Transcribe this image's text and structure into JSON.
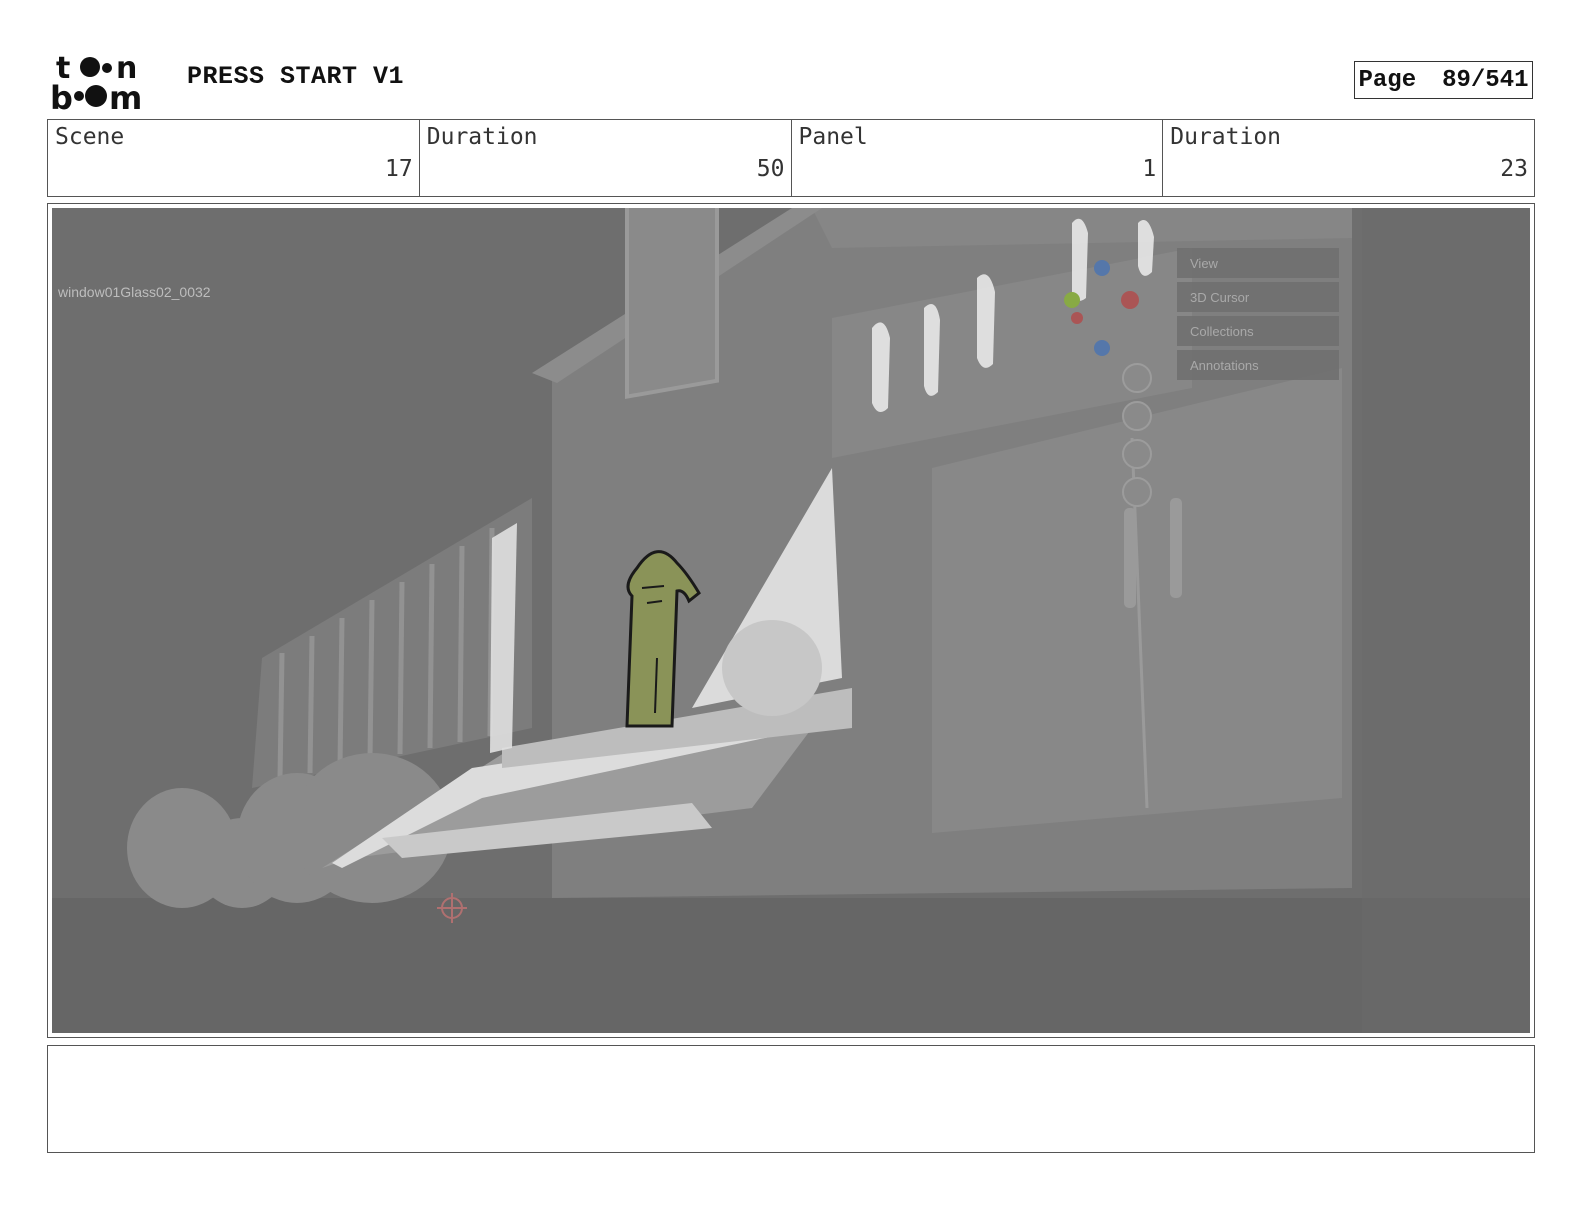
{
  "header": {
    "logo_text": "toon boom",
    "project_title": "PRESS START V1",
    "page_label": "Page",
    "page_number": "89/541"
  },
  "info": {
    "scene_label": "Scene",
    "scene_value": "17",
    "scene_duration_label": "Duration",
    "scene_duration_value": "50",
    "panel_label": "Panel",
    "panel_value": "1",
    "panel_duration_label": "Duration",
    "panel_duration_value": "23"
  },
  "panel_image": {
    "object_label": "window01Glass02_0032",
    "menu_items": [
      "View",
      "3D Cursor",
      "Collections",
      "Annotations"
    ],
    "tool_icons": [
      "zoom-icon",
      "hand-pan-icon",
      "camera-icon",
      "grid-icon"
    ]
  },
  "notes": {
    "text": ""
  }
}
